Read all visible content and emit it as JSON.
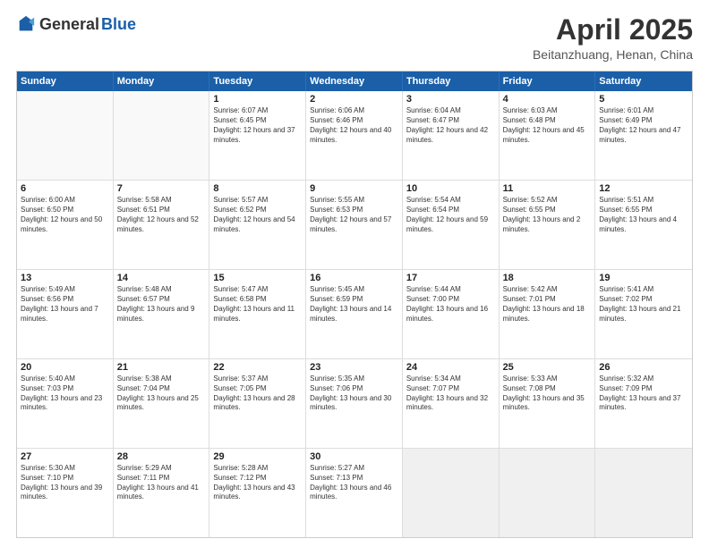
{
  "logo": {
    "general": "General",
    "blue": "Blue"
  },
  "header": {
    "title": "April 2025",
    "subtitle": "Beitanzhuang, Henan, China"
  },
  "days": [
    "Sunday",
    "Monday",
    "Tuesday",
    "Wednesday",
    "Thursday",
    "Friday",
    "Saturday"
  ],
  "weeks": [
    [
      {
        "day": "",
        "content": ""
      },
      {
        "day": "",
        "content": ""
      },
      {
        "day": "1",
        "content": "Sunrise: 6:07 AM\nSunset: 6:45 PM\nDaylight: 12 hours and 37 minutes."
      },
      {
        "day": "2",
        "content": "Sunrise: 6:06 AM\nSunset: 6:46 PM\nDaylight: 12 hours and 40 minutes."
      },
      {
        "day": "3",
        "content": "Sunrise: 6:04 AM\nSunset: 6:47 PM\nDaylight: 12 hours and 42 minutes."
      },
      {
        "day": "4",
        "content": "Sunrise: 6:03 AM\nSunset: 6:48 PM\nDaylight: 12 hours and 45 minutes."
      },
      {
        "day": "5",
        "content": "Sunrise: 6:01 AM\nSunset: 6:49 PM\nDaylight: 12 hours and 47 minutes."
      }
    ],
    [
      {
        "day": "6",
        "content": "Sunrise: 6:00 AM\nSunset: 6:50 PM\nDaylight: 12 hours and 50 minutes."
      },
      {
        "day": "7",
        "content": "Sunrise: 5:58 AM\nSunset: 6:51 PM\nDaylight: 12 hours and 52 minutes."
      },
      {
        "day": "8",
        "content": "Sunrise: 5:57 AM\nSunset: 6:52 PM\nDaylight: 12 hours and 54 minutes."
      },
      {
        "day": "9",
        "content": "Sunrise: 5:55 AM\nSunset: 6:53 PM\nDaylight: 12 hours and 57 minutes."
      },
      {
        "day": "10",
        "content": "Sunrise: 5:54 AM\nSunset: 6:54 PM\nDaylight: 12 hours and 59 minutes."
      },
      {
        "day": "11",
        "content": "Sunrise: 5:52 AM\nSunset: 6:55 PM\nDaylight: 13 hours and 2 minutes."
      },
      {
        "day": "12",
        "content": "Sunrise: 5:51 AM\nSunset: 6:55 PM\nDaylight: 13 hours and 4 minutes."
      }
    ],
    [
      {
        "day": "13",
        "content": "Sunrise: 5:49 AM\nSunset: 6:56 PM\nDaylight: 13 hours and 7 minutes."
      },
      {
        "day": "14",
        "content": "Sunrise: 5:48 AM\nSunset: 6:57 PM\nDaylight: 13 hours and 9 minutes."
      },
      {
        "day": "15",
        "content": "Sunrise: 5:47 AM\nSunset: 6:58 PM\nDaylight: 13 hours and 11 minutes."
      },
      {
        "day": "16",
        "content": "Sunrise: 5:45 AM\nSunset: 6:59 PM\nDaylight: 13 hours and 14 minutes."
      },
      {
        "day": "17",
        "content": "Sunrise: 5:44 AM\nSunset: 7:00 PM\nDaylight: 13 hours and 16 minutes."
      },
      {
        "day": "18",
        "content": "Sunrise: 5:42 AM\nSunset: 7:01 PM\nDaylight: 13 hours and 18 minutes."
      },
      {
        "day": "19",
        "content": "Sunrise: 5:41 AM\nSunset: 7:02 PM\nDaylight: 13 hours and 21 minutes."
      }
    ],
    [
      {
        "day": "20",
        "content": "Sunrise: 5:40 AM\nSunset: 7:03 PM\nDaylight: 13 hours and 23 minutes."
      },
      {
        "day": "21",
        "content": "Sunrise: 5:38 AM\nSunset: 7:04 PM\nDaylight: 13 hours and 25 minutes."
      },
      {
        "day": "22",
        "content": "Sunrise: 5:37 AM\nSunset: 7:05 PM\nDaylight: 13 hours and 28 minutes."
      },
      {
        "day": "23",
        "content": "Sunrise: 5:35 AM\nSunset: 7:06 PM\nDaylight: 13 hours and 30 minutes."
      },
      {
        "day": "24",
        "content": "Sunrise: 5:34 AM\nSunset: 7:07 PM\nDaylight: 13 hours and 32 minutes."
      },
      {
        "day": "25",
        "content": "Sunrise: 5:33 AM\nSunset: 7:08 PM\nDaylight: 13 hours and 35 minutes."
      },
      {
        "day": "26",
        "content": "Sunrise: 5:32 AM\nSunset: 7:09 PM\nDaylight: 13 hours and 37 minutes."
      }
    ],
    [
      {
        "day": "27",
        "content": "Sunrise: 5:30 AM\nSunset: 7:10 PM\nDaylight: 13 hours and 39 minutes."
      },
      {
        "day": "28",
        "content": "Sunrise: 5:29 AM\nSunset: 7:11 PM\nDaylight: 13 hours and 41 minutes."
      },
      {
        "day": "29",
        "content": "Sunrise: 5:28 AM\nSunset: 7:12 PM\nDaylight: 13 hours and 43 minutes."
      },
      {
        "day": "30",
        "content": "Sunrise: 5:27 AM\nSunset: 7:13 PM\nDaylight: 13 hours and 46 minutes."
      },
      {
        "day": "",
        "content": ""
      },
      {
        "day": "",
        "content": ""
      },
      {
        "day": "",
        "content": ""
      }
    ]
  ]
}
